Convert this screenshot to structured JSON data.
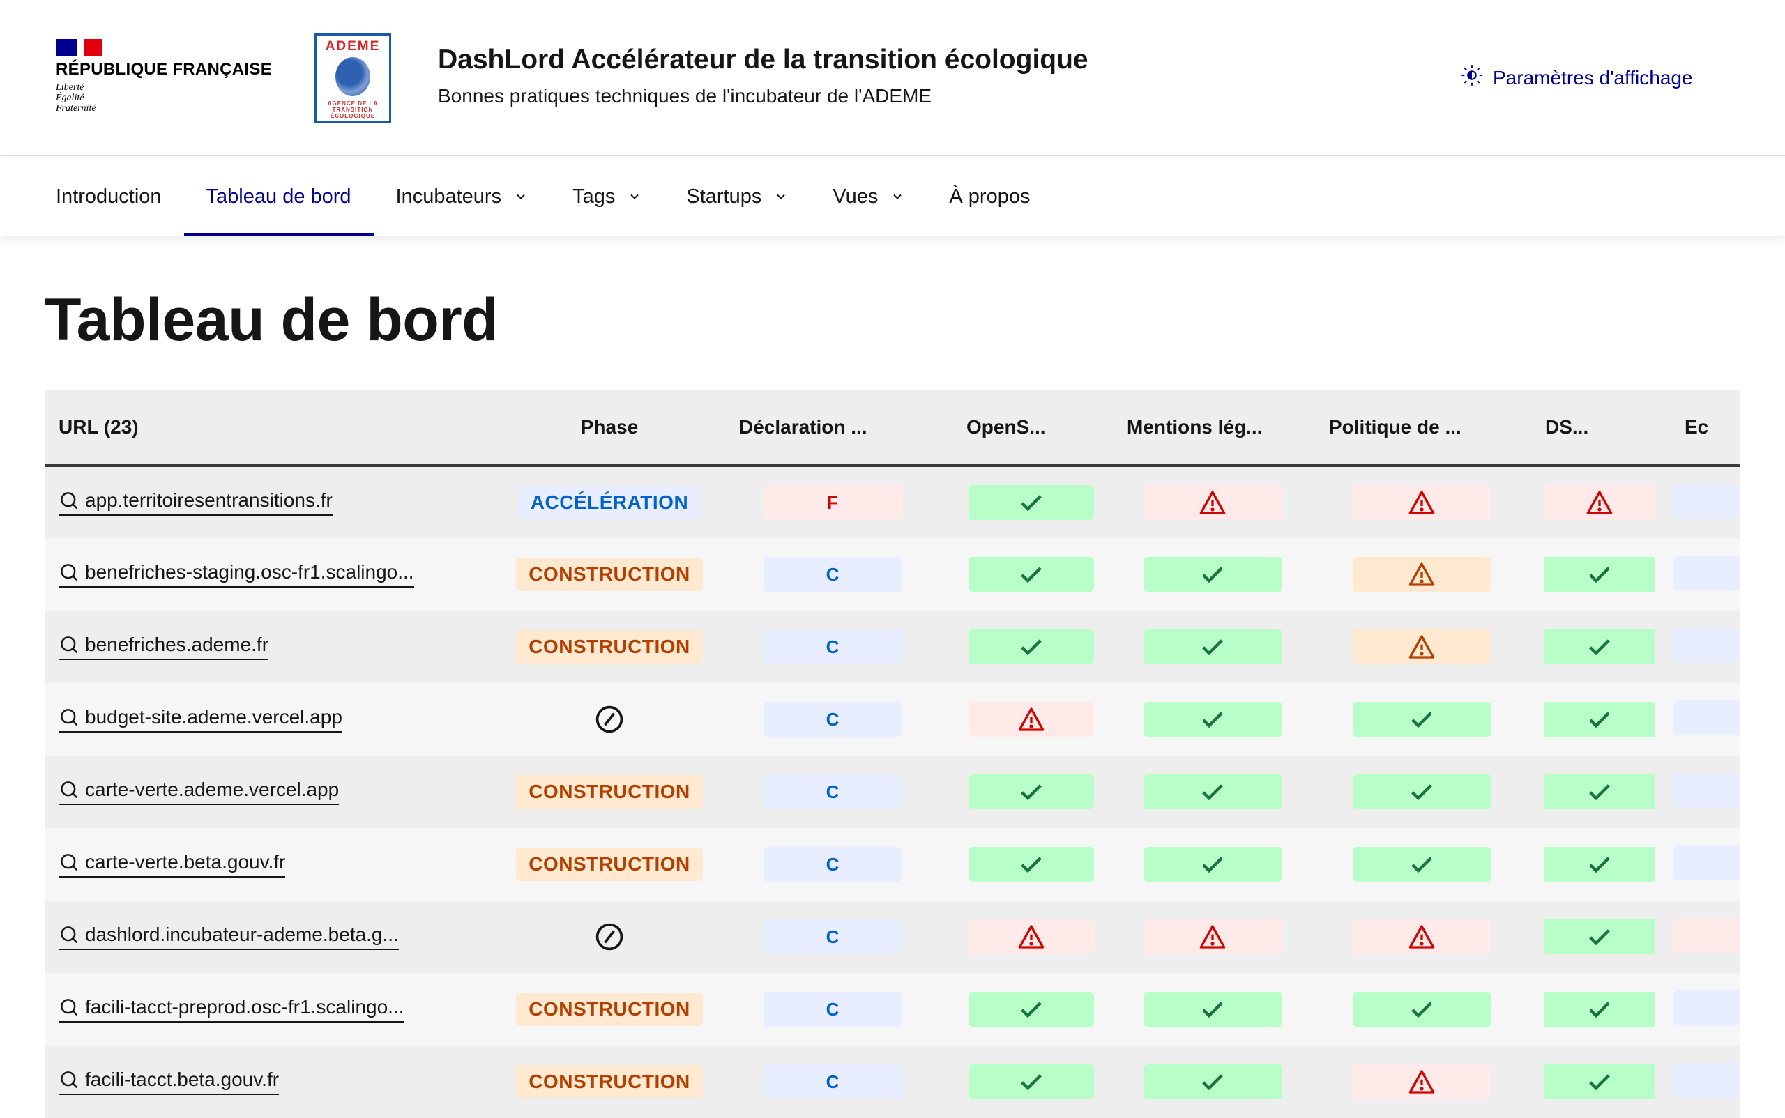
{
  "header": {
    "republic_name": "RÉPUBLIQUE FRANÇAISE",
    "motto": [
      "Liberté",
      "Égalité",
      "Fraternité"
    ],
    "partner_logo": {
      "name": "ADEME",
      "tagline": [
        "AGENCE DE LA",
        "TRANSITION",
        "ÉCOLOGIQUE"
      ]
    },
    "site_title": "DashLord Accélérateur de la transition écologique",
    "site_subtitle": "Bonnes pratiques techniques de l'incubateur de l'ADEME",
    "display_settings_label": "Paramètres d'affichage",
    "display_settings_icon": "theme-icon"
  },
  "nav": {
    "items": [
      {
        "label": "Introduction",
        "dropdown": false,
        "active": false
      },
      {
        "label": "Tableau de bord",
        "dropdown": false,
        "active": true
      },
      {
        "label": "Incubateurs",
        "dropdown": true,
        "active": false
      },
      {
        "label": "Tags",
        "dropdown": true,
        "active": false
      },
      {
        "label": "Startups",
        "dropdown": true,
        "active": false
      },
      {
        "label": "Vues",
        "dropdown": true,
        "active": false
      },
      {
        "label": "À propos",
        "dropdown": false,
        "active": false
      }
    ]
  },
  "page": {
    "title": "Tableau de bord"
  },
  "table": {
    "columns": [
      "URL (23)",
      "Phase",
      "Déclaration ...",
      "OpenS...",
      "Mentions lég...",
      "Politique de ...",
      "DS...",
      "Ec"
    ],
    "colors": {
      "info": "#0063cb",
      "error": "#ce0500",
      "success": "#18753c",
      "warning": "#b34000",
      "active_nav": "#000091"
    },
    "rows": [
      {
        "url": "app.territoiresentransitions.fr",
        "phase": "ACCÉLÉRATION",
        "phase_type": "acc",
        "cells": [
          {
            "type": "error",
            "text": "F"
          },
          {
            "type": "success",
            "icon": "check"
          },
          {
            "type": "error",
            "icon": "warning"
          },
          {
            "type": "error",
            "icon": "warning"
          },
          {
            "type": "error",
            "icon": "warning"
          },
          {
            "type": "info",
            "text": ""
          }
        ]
      },
      {
        "url": "benefriches-staging.osc-fr1.scalingo...",
        "phase": "CONSTRUCTION",
        "phase_type": "cons",
        "cells": [
          {
            "type": "info",
            "text": "C"
          },
          {
            "type": "success",
            "icon": "check"
          },
          {
            "type": "success",
            "icon": "check"
          },
          {
            "type": "warning",
            "icon": "warning"
          },
          {
            "type": "success",
            "icon": "check"
          },
          {
            "type": "info",
            "text": ""
          }
        ]
      },
      {
        "url": "benefriches.ademe.fr",
        "phase": "CONSTRUCTION",
        "phase_type": "cons",
        "cells": [
          {
            "type": "info",
            "text": "C"
          },
          {
            "type": "success",
            "icon": "check"
          },
          {
            "type": "success",
            "icon": "check"
          },
          {
            "type": "warning",
            "icon": "warning"
          },
          {
            "type": "success",
            "icon": "check"
          },
          {
            "type": "info",
            "text": ""
          }
        ]
      },
      {
        "url": "budget-site.ademe.vercel.app",
        "phase": "",
        "phase_type": "none",
        "cells": [
          {
            "type": "info",
            "text": "C"
          },
          {
            "type": "error",
            "icon": "warning"
          },
          {
            "type": "success",
            "icon": "check"
          },
          {
            "type": "success",
            "icon": "check"
          },
          {
            "type": "success",
            "icon": "check"
          },
          {
            "type": "info",
            "text": ""
          }
        ]
      },
      {
        "url": "carte-verte.ademe.vercel.app",
        "phase": "CONSTRUCTION",
        "phase_type": "cons",
        "cells": [
          {
            "type": "info",
            "text": "C"
          },
          {
            "type": "success",
            "icon": "check"
          },
          {
            "type": "success",
            "icon": "check"
          },
          {
            "type": "success",
            "icon": "check"
          },
          {
            "type": "success",
            "icon": "check"
          },
          {
            "type": "info",
            "text": ""
          }
        ]
      },
      {
        "url": "carte-verte.beta.gouv.fr",
        "phase": "CONSTRUCTION",
        "phase_type": "cons",
        "cells": [
          {
            "type": "info",
            "text": "C"
          },
          {
            "type": "success",
            "icon": "check"
          },
          {
            "type": "success",
            "icon": "check"
          },
          {
            "type": "success",
            "icon": "check"
          },
          {
            "type": "success",
            "icon": "check"
          },
          {
            "type": "info",
            "text": ""
          }
        ]
      },
      {
        "url": "dashlord.incubateur-ademe.beta.g...",
        "phase": "",
        "phase_type": "none",
        "cells": [
          {
            "type": "info",
            "text": "C"
          },
          {
            "type": "error",
            "icon": "warning"
          },
          {
            "type": "error",
            "icon": "warning"
          },
          {
            "type": "error",
            "icon": "warning"
          },
          {
            "type": "success",
            "icon": "check"
          },
          {
            "type": "error",
            "text": ""
          }
        ]
      },
      {
        "url": "facili-tacct-preprod.osc-fr1.scalingo...",
        "phase": "CONSTRUCTION",
        "phase_type": "cons",
        "cells": [
          {
            "type": "info",
            "text": "C"
          },
          {
            "type": "success",
            "icon": "check"
          },
          {
            "type": "success",
            "icon": "check"
          },
          {
            "type": "success",
            "icon": "check"
          },
          {
            "type": "success",
            "icon": "check"
          },
          {
            "type": "info",
            "text": ""
          }
        ]
      },
      {
        "url": "facili-tacct.beta.gouv.fr",
        "phase": "CONSTRUCTION",
        "phase_type": "cons",
        "cells": [
          {
            "type": "info",
            "text": "C"
          },
          {
            "type": "success",
            "icon": "check"
          },
          {
            "type": "success",
            "icon": "check"
          },
          {
            "type": "error",
            "icon": "warning"
          },
          {
            "type": "success",
            "icon": "check"
          },
          {
            "type": "info",
            "text": ""
          }
        ]
      }
    ]
  }
}
